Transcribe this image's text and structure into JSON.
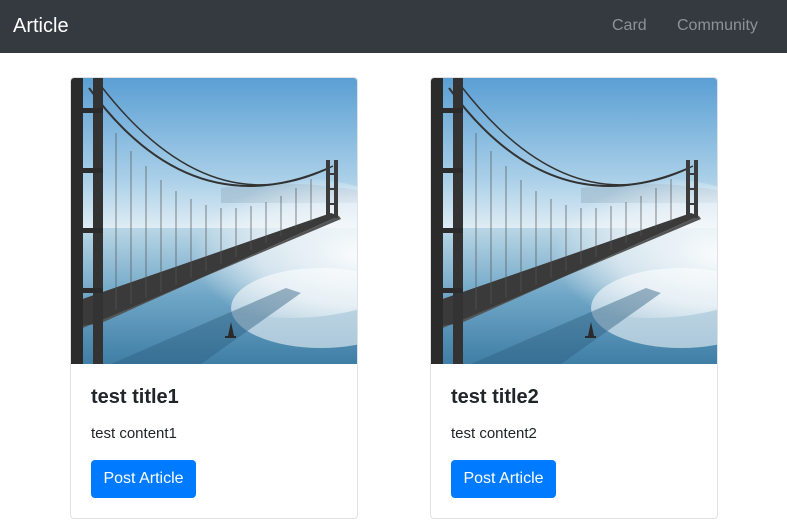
{
  "navbar": {
    "brand": "Article",
    "links": [
      {
        "label": "Card"
      },
      {
        "label": "Community"
      }
    ]
  },
  "cards": [
    {
      "title": "test title1",
      "content": "test content1",
      "button_label": "Post Article",
      "image": "bridge-photo"
    },
    {
      "title": "test title2",
      "content": "test content2",
      "button_label": "Post Article",
      "image": "bridge-photo"
    }
  ],
  "colors": {
    "navbar_bg": "#343a40",
    "primary": "#007bff",
    "nav_link": "#8e9296",
    "text": "#212529"
  }
}
